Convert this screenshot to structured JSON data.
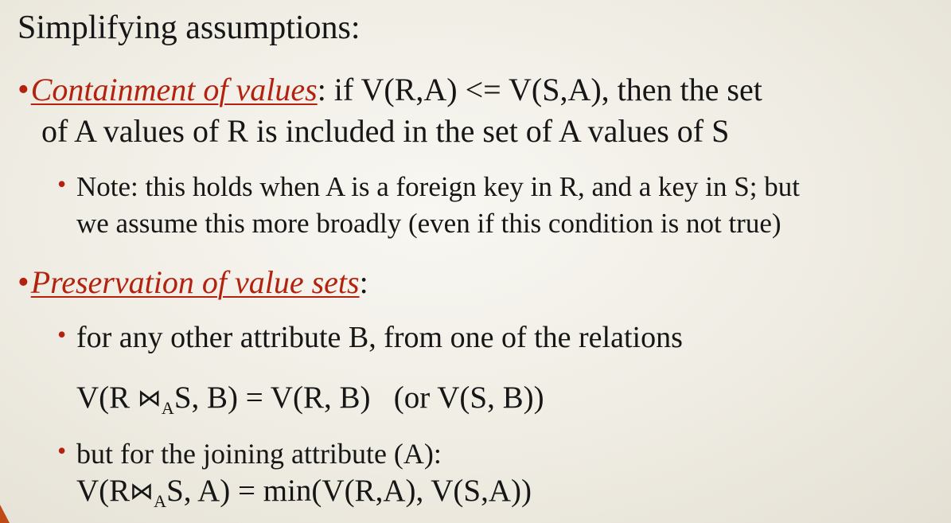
{
  "heading": "Simplifying assumptions:",
  "bullet_glyph": "•",
  "join_symbol": "⋈",
  "join_subscript": "A",
  "accent_color": "#b3220e",
  "item1": {
    "term": "Containment of values",
    "text_part1": ": if V(R,A) <= V(S,A), then the set",
    "text_part2": "of A values of R is included in the set of A values of S",
    "note_part1": "Note: this holds when A is a foreign key in R, and a key in S; but",
    "note_part2": "we assume this more broadly (even if this condition is not true)"
  },
  "item2": {
    "term": "Preservation of value sets",
    "colon": ":",
    "sub1": "for any other attribute B, from one of the relations",
    "formula1_prefix": "V(R ",
    "formula1_suffix": "S, B) = V(R, B)   (or V(S, B))",
    "sub2": "but for the joining attribute (A):",
    "formula2_prefix": "V(R",
    "formula2_suffix": "S, A) = min(V(R,A), V(S,A))"
  }
}
